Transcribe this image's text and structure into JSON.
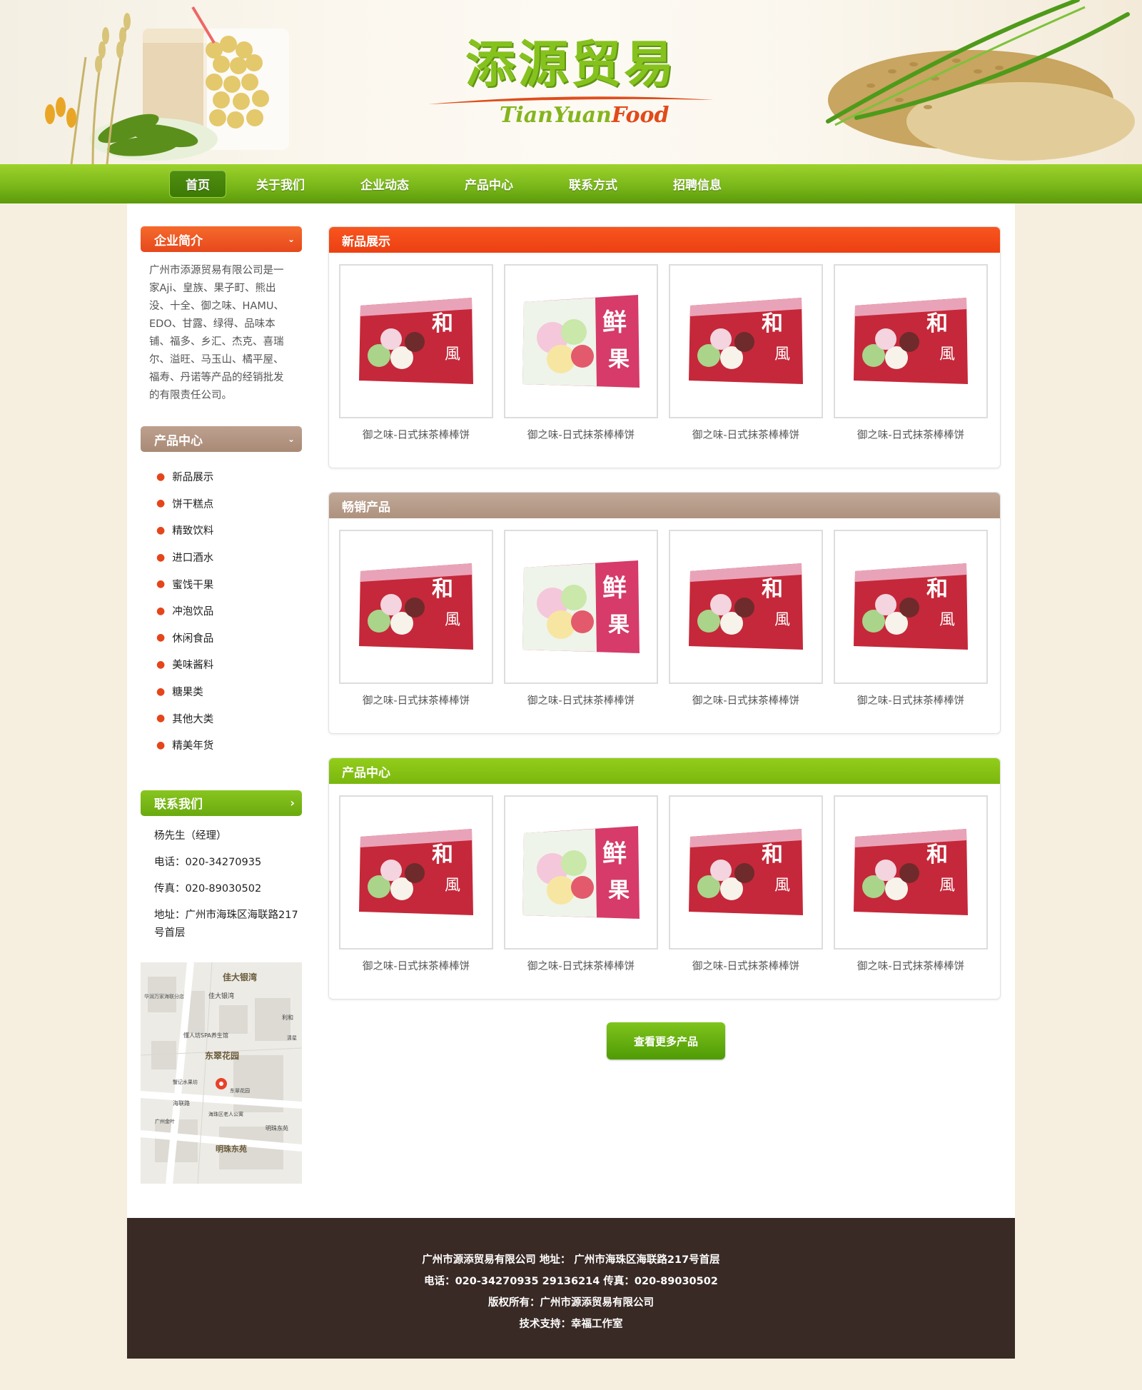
{
  "header": {
    "logo_cn": "添源贸易",
    "logo_en_a": "TianYuan",
    "logo_en_b": "Food"
  },
  "nav": {
    "items": [
      {
        "label": "首页",
        "active": true
      },
      {
        "label": "关于我们"
      },
      {
        "label": "企业动态"
      },
      {
        "label": "产品中心"
      },
      {
        "label": "联系方式"
      },
      {
        "label": "招聘信息"
      }
    ]
  },
  "sidebar": {
    "intro_title": "企业简介",
    "intro_text": "广州市添源贸易有限公司是一家Aji、皇族、果子町、熊出没、十全、御之味、HAMU、EDO、甘露、绿得、品味本铺、福多、乡汇、杰克、喜瑞尔、溢旺、马玉山、橘平屋、福寿、丹诺等产品的经销批发的有限责任公司。",
    "products_title": "产品中心",
    "categories": [
      "新品展示",
      "饼干糕点",
      "精致饮料",
      "进口酒水",
      "蜜饯干果",
      "冲泡饮品",
      "休闲食品",
      "美味酱料",
      "糖果类",
      "其他大类",
      "精美年货"
    ],
    "contact_title": "联系我们",
    "contact": {
      "person": "杨先生（经理）",
      "phone": "电话：020-34270935",
      "fax": "传真：020-89030502",
      "address": "地址：广州市海珠区海联路217号首层"
    },
    "map_labels": [
      "佳大银湾",
      "佳大银湾",
      "华润万家海联分店",
      "利和",
      "清星",
      "懂人坊SPA养生馆",
      "东翠花园",
      "东翠花园",
      "蟹记水果坊",
      "海联路",
      "海珠区老人公寓",
      "广州金叶",
      "明珠东苑",
      "明珠东苑"
    ]
  },
  "sections": [
    {
      "title": "新品展示",
      "color": "#f04a1a"
    },
    {
      "title": "畅销产品",
      "color": "#b59c8c"
    },
    {
      "title": "产品中心",
      "color": "#86c21a"
    }
  ],
  "product_caption": "御之味-日式抹茶棒棒饼",
  "more_button": "查看更多产品",
  "footer": {
    "line1": "广州市源添贸易有限公司 地址： 广州市海珠区海联路217号首层",
    "line2": "电话：020-34270935 29136214 传真：020-89030502",
    "line3": "版权所有：广州市源添贸易有限公司",
    "line4": "技术支持：幸福工作室"
  }
}
